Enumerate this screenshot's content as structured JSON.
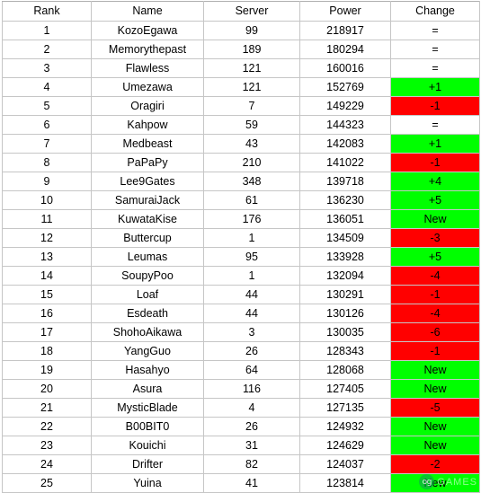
{
  "table": {
    "columns": [
      {
        "key": "rank",
        "label": "Rank"
      },
      {
        "key": "name",
        "label": "Name"
      },
      {
        "key": "server",
        "label": "Server"
      },
      {
        "key": "power",
        "label": "Power"
      },
      {
        "key": "change",
        "label": "Change"
      }
    ],
    "rows": [
      {
        "rank": "1",
        "name": "KozoEgawa",
        "server": "99",
        "power": "218917",
        "change": "=",
        "change_state": "same"
      },
      {
        "rank": "2",
        "name": "Memorythepast",
        "server": "189",
        "power": "180294",
        "change": "=",
        "change_state": "same"
      },
      {
        "rank": "3",
        "name": "Flawless",
        "server": "121",
        "power": "160016",
        "change": "=",
        "change_state": "same"
      },
      {
        "rank": "4",
        "name": "Umezawa",
        "server": "121",
        "power": "152769",
        "change": "+1",
        "change_state": "up"
      },
      {
        "rank": "5",
        "name": "Oragiri",
        "server": "7",
        "power": "149229",
        "change": "-1",
        "change_state": "down"
      },
      {
        "rank": "6",
        "name": "Kahpow",
        "server": "59",
        "power": "144323",
        "change": "=",
        "change_state": "same"
      },
      {
        "rank": "7",
        "name": "Medbeast",
        "server": "43",
        "power": "142083",
        "change": "+1",
        "change_state": "up"
      },
      {
        "rank": "8",
        "name": "PaPaPy",
        "server": "210",
        "power": "141022",
        "change": "-1",
        "change_state": "down"
      },
      {
        "rank": "9",
        "name": "Lee9Gates",
        "server": "348",
        "power": "139718",
        "change": "+4",
        "change_state": "up"
      },
      {
        "rank": "10",
        "name": "SamuraiJack",
        "server": "61",
        "power": "136230",
        "change": "+5",
        "change_state": "up"
      },
      {
        "rank": "11",
        "name": "KuwataKise",
        "server": "176",
        "power": "136051",
        "change": "New",
        "change_state": "new"
      },
      {
        "rank": "12",
        "name": "Buttercup",
        "server": "1",
        "power": "134509",
        "change": "-3",
        "change_state": "down"
      },
      {
        "rank": "13",
        "name": "Leumas",
        "server": "95",
        "power": "133928",
        "change": "+5",
        "change_state": "up"
      },
      {
        "rank": "14",
        "name": "SoupyPoo",
        "server": "1",
        "power": "132094",
        "change": "-4",
        "change_state": "down"
      },
      {
        "rank": "15",
        "name": "Loaf",
        "server": "44",
        "power": "130291",
        "change": "-1",
        "change_state": "down"
      },
      {
        "rank": "16",
        "name": "Esdeath",
        "server": "44",
        "power": "130126",
        "change": "-4",
        "change_state": "down"
      },
      {
        "rank": "17",
        "name": "ShohoAikawa",
        "server": "3",
        "power": "130035",
        "change": "-6",
        "change_state": "down"
      },
      {
        "rank": "18",
        "name": "YangGuo",
        "server": "26",
        "power": "128343",
        "change": "-1",
        "change_state": "down"
      },
      {
        "rank": "19",
        "name": "Hasahyo",
        "server": "64",
        "power": "128068",
        "change": "New",
        "change_state": "new"
      },
      {
        "rank": "20",
        "name": "Asura",
        "server": "116",
        "power": "127405",
        "change": "New",
        "change_state": "new"
      },
      {
        "rank": "21",
        "name": "MysticBlade",
        "server": "4",
        "power": "127135",
        "change": "-5",
        "change_state": "down"
      },
      {
        "rank": "22",
        "name": "B00BIT0",
        "server": "26",
        "power": "124932",
        "change": "New",
        "change_state": "new"
      },
      {
        "rank": "23",
        "name": "Kouichi",
        "server": "31",
        "power": "124629",
        "change": "New",
        "change_state": "new"
      },
      {
        "rank": "24",
        "name": "Drifter",
        "server": "82",
        "power": "124037",
        "change": "-2",
        "change_state": "down"
      },
      {
        "rank": "25",
        "name": "Yuina",
        "server": "41",
        "power": "123814",
        "change": "New",
        "change_state": "new"
      }
    ]
  },
  "watermark": {
    "logo_text": "og",
    "text": "GAMES"
  },
  "colors": {
    "change_up": "#00ff00",
    "change_down": "#ff0000",
    "change_same": "#ffffff",
    "grid_line": "#c6c6c6"
  }
}
